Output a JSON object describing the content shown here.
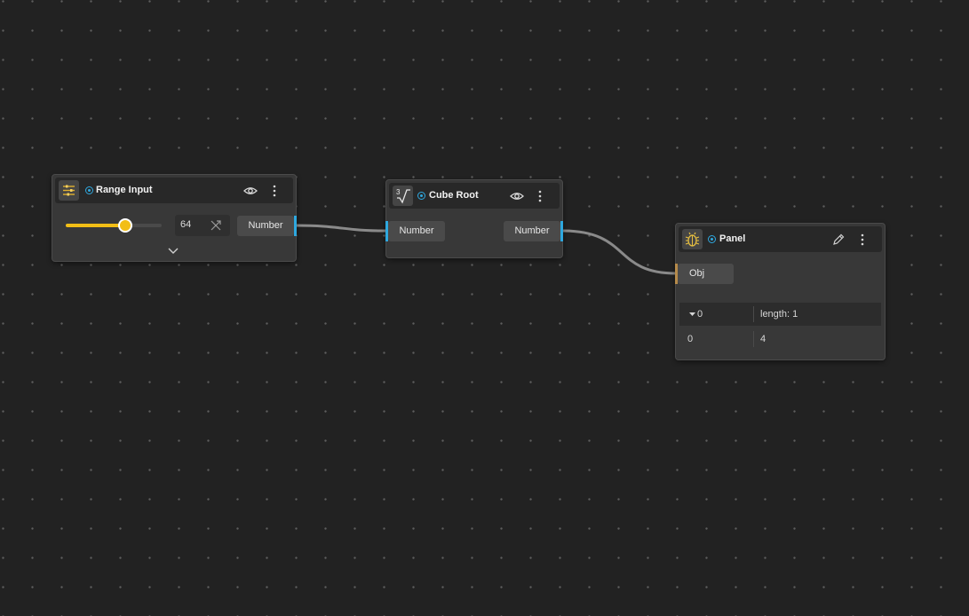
{
  "nodes": {
    "range_input": {
      "title": "Range Input",
      "value": "64",
      "slider_fraction": 0.62,
      "output_label": "Number"
    },
    "cube_root": {
      "title": "Cube Root",
      "input_label": "Number",
      "output_label": "Number"
    },
    "panel": {
      "title": "Panel",
      "input_label": "Obj",
      "header_row": {
        "key": "0",
        "value": "length: 1"
      },
      "rows": [
        {
          "key": "0",
          "value": "4"
        }
      ]
    }
  },
  "colors": {
    "canvas": "#222222",
    "node": "#383838",
    "accent_blue": "#2ea8df",
    "slider_yellow": "#f2be16",
    "obj_port": "#b58a4a",
    "wire": "#8a8a8a"
  },
  "icons": {
    "range_input": "sliders-icon",
    "cube_root": "cube-root-icon",
    "panel": "bug-icon"
  }
}
